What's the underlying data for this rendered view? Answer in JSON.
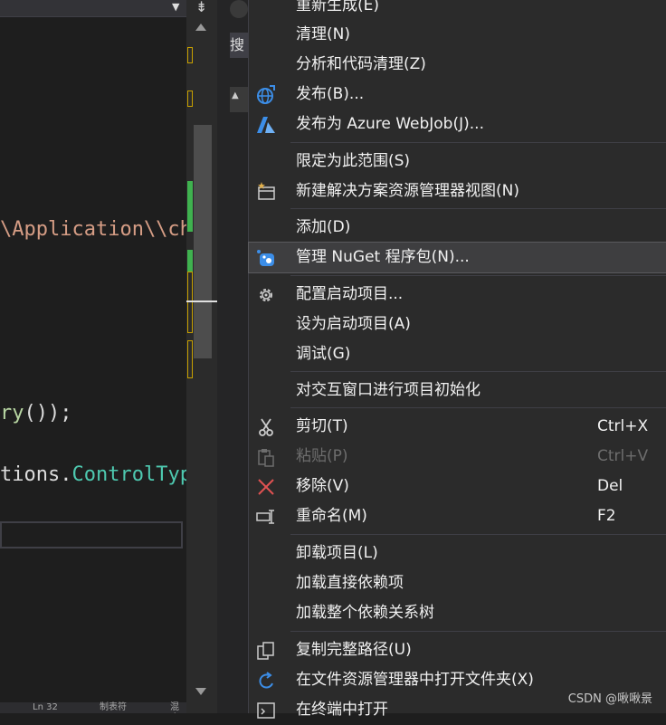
{
  "editor": {
    "line1": "\\Application\\\\ch",
    "line2": "ry());",
    "line3": "tions.ControlTyp"
  },
  "status_fragments": [
    "Ln 32",
    "制表符",
    "混合"
  ],
  "context_menu": {
    "items": [
      {
        "label": "重新生成(E)",
        "icon": "none",
        "shortcut": ""
      },
      {
        "label": "清理(N)",
        "icon": "none",
        "shortcut": ""
      },
      {
        "label": "分析和代码清理(Z)",
        "icon": "none",
        "shortcut": ""
      },
      {
        "label": "发布(B)...",
        "icon": "globe-publish-icon",
        "shortcut": ""
      },
      {
        "label": "发布为 Azure WebJob(J)...",
        "icon": "azure-icon",
        "shortcut": ""
      },
      {
        "label": "限定为此范围(S)",
        "icon": "none",
        "shortcut": ""
      },
      {
        "label": "新建解决方案资源管理器视图(N)",
        "icon": "new-view-icon",
        "shortcut": ""
      },
      {
        "label": "添加(D)",
        "icon": "none",
        "shortcut": ""
      },
      {
        "label": "管理 NuGet 程序包(N)...",
        "icon": "nuget-icon",
        "shortcut": ""
      },
      {
        "label": "配置启动项目...",
        "icon": "gear-icon",
        "shortcut": ""
      },
      {
        "label": "设为启动项目(A)",
        "icon": "none",
        "shortcut": ""
      },
      {
        "label": "调试(G)",
        "icon": "none",
        "shortcut": ""
      },
      {
        "label": "对交互窗口进行项目初始化",
        "icon": "none",
        "shortcut": ""
      },
      {
        "label": "剪切(T)",
        "icon": "scissors-icon",
        "shortcut": "Ctrl+X"
      },
      {
        "label": "粘贴(P)",
        "icon": "paste-icon",
        "shortcut": "Ctrl+V"
      },
      {
        "label": "移除(V)",
        "icon": "remove-x-icon",
        "shortcut": "Del"
      },
      {
        "label": "重命名(M)",
        "icon": "rename-icon",
        "shortcut": "F2"
      },
      {
        "label": "卸载项目(L)",
        "icon": "none",
        "shortcut": ""
      },
      {
        "label": "加载直接依赖项",
        "icon": "none",
        "shortcut": ""
      },
      {
        "label": "加载整个依赖关系树",
        "icon": "none",
        "shortcut": ""
      },
      {
        "label": "复制完整路径(U)",
        "icon": "copy-icon",
        "shortcut": ""
      },
      {
        "label": "在文件资源管理器中打开文件夹(X)",
        "icon": "open-folder-icon",
        "shortcut": ""
      },
      {
        "label": "在终端中打开",
        "icon": "terminal-icon",
        "shortcut": ""
      }
    ]
  },
  "side_tab": "搜",
  "watermark": "CSDN @啾啾景",
  "colors": {
    "highlight": "#3e3e40",
    "string": "#d69d85",
    "type": "#4ec9b0"
  }
}
